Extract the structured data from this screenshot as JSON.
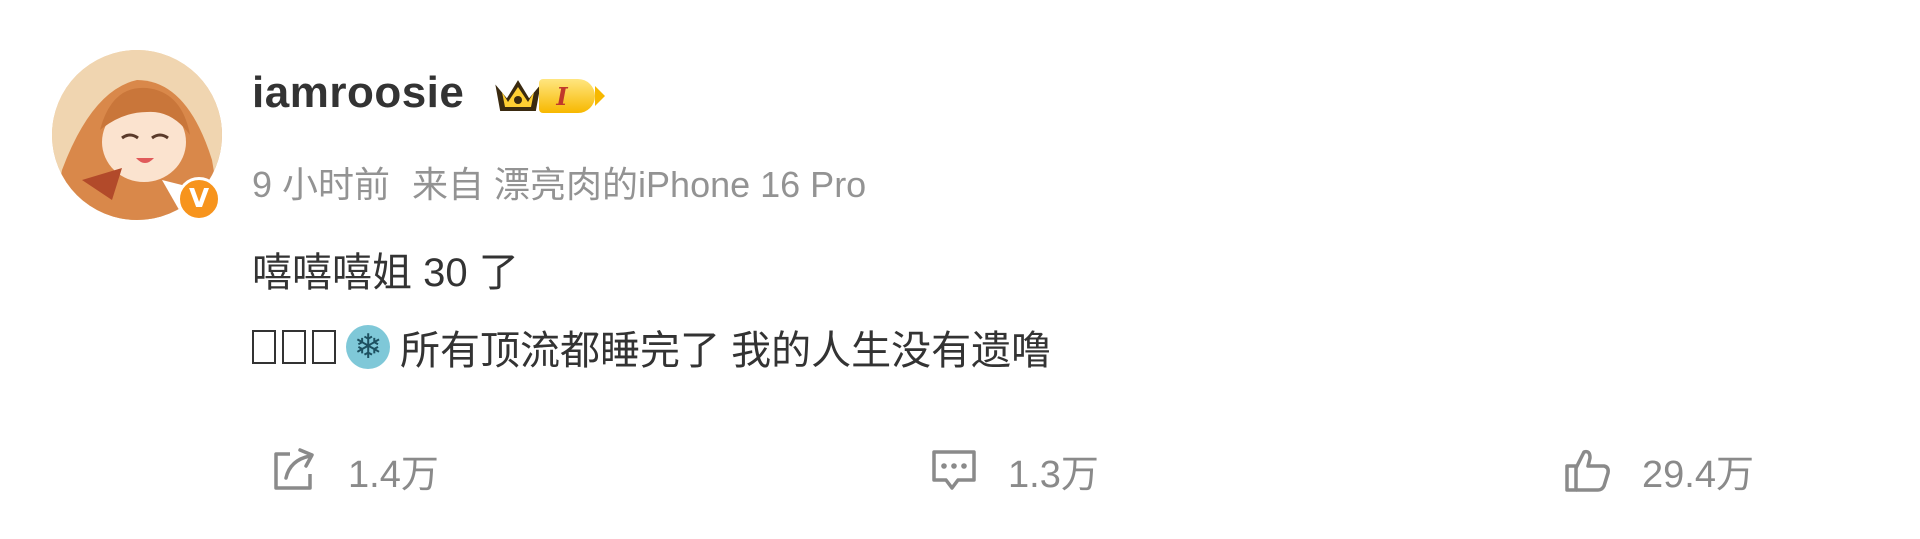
{
  "post": {
    "author": {
      "username": "iamroosie",
      "verified_badge": "V",
      "level": "I"
    },
    "meta": {
      "time": "9 小时前",
      "source": "来自 漂亮肉的iPhone 16 Pro"
    },
    "content": {
      "line1": "嘻嘻嘻姐 30 了",
      "line2_text": "所有顶流都睡完了 我的人生没有遗噜"
    },
    "actions": {
      "repost_count": "1.4万",
      "comment_count": "1.3万",
      "like_count": "29.4万"
    },
    "colors": {
      "accent_orange": "#f7941d",
      "text_primary": "#333333",
      "text_secondary": "#939393"
    },
    "icons": [
      "crown-icon",
      "verified-icon",
      "snowflake-emoji",
      "repost-icon",
      "comment-icon",
      "like-icon"
    ]
  }
}
